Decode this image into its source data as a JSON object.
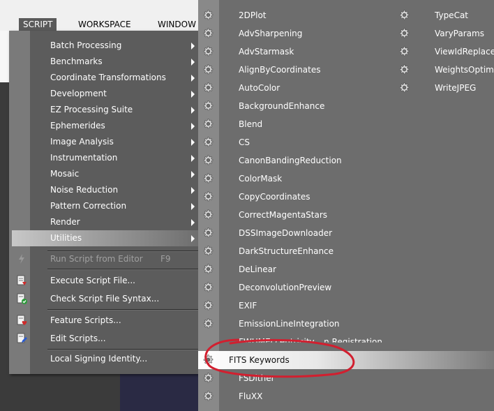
{
  "menubar": {
    "items": [
      {
        "label": "SCRIPT"
      },
      {
        "label": "WORKSPACE"
      },
      {
        "label": "WINDOW"
      }
    ]
  },
  "script_menu": {
    "submenus": [
      {
        "label": "Batch Processing"
      },
      {
        "label": "Benchmarks"
      },
      {
        "label": "Coordinate Transformations"
      },
      {
        "label": "Development"
      },
      {
        "label": "EZ Processing Suite"
      },
      {
        "label": "Ephemerides"
      },
      {
        "label": "Image Analysis"
      },
      {
        "label": "Instrumentation"
      },
      {
        "label": "Mosaic"
      },
      {
        "label": "Noise Reduction"
      },
      {
        "label": "Pattern Correction"
      },
      {
        "label": "Render"
      },
      {
        "label": "Utilities"
      }
    ],
    "run_from_editor": {
      "label": "Run Script from Editor",
      "shortcut": "F9"
    },
    "execute_file": {
      "label": "Execute Script File..."
    },
    "check_syntax": {
      "label": "Check Script File Syntax..."
    },
    "feature_scripts": {
      "label": "Feature Scripts..."
    },
    "edit_scripts": {
      "label": "Edit Scripts..."
    },
    "signing": {
      "label": "Local Signing Identity..."
    }
  },
  "utilities_menu": {
    "column1": [
      {
        "label": "2DPlot"
      },
      {
        "label": "AdvSharpening"
      },
      {
        "label": "AdvStarmask"
      },
      {
        "label": "AlignByCoordinates"
      },
      {
        "label": "AutoColor"
      },
      {
        "label": "BackgroundEnhance"
      },
      {
        "label": "Blend"
      },
      {
        "label": "CS"
      },
      {
        "label": "CanonBandingReduction"
      },
      {
        "label": "ColorMask"
      },
      {
        "label": "CopyCoordinates"
      },
      {
        "label": "CorrectMagentaStars"
      },
      {
        "label": "DSSImageDownloader"
      },
      {
        "label": "DarkStructureEnhance"
      },
      {
        "label": "DeLinear"
      },
      {
        "label": "DeconvolutionPreview"
      },
      {
        "label": "EXIF"
      },
      {
        "label": "EmissionLineIntegration"
      },
      {
        "label": "FITS Keywords"
      },
      {
        "label": "FSDither"
      },
      {
        "label": "FluXX"
      }
    ],
    "column2": [
      {
        "label": "TypeCat"
      },
      {
        "label": "VaryParams"
      },
      {
        "label": "ViewIdReplace"
      },
      {
        "label": "WeightsOptimiz"
      },
      {
        "label": "WriteJPEG"
      }
    ],
    "partial_label": "FWHMEccentricity... n Registration"
  },
  "colors": {
    "annotation": "#d21f2f",
    "menu_bg": "#5c5c5c",
    "submenu_bg": "#6d6d6d"
  }
}
